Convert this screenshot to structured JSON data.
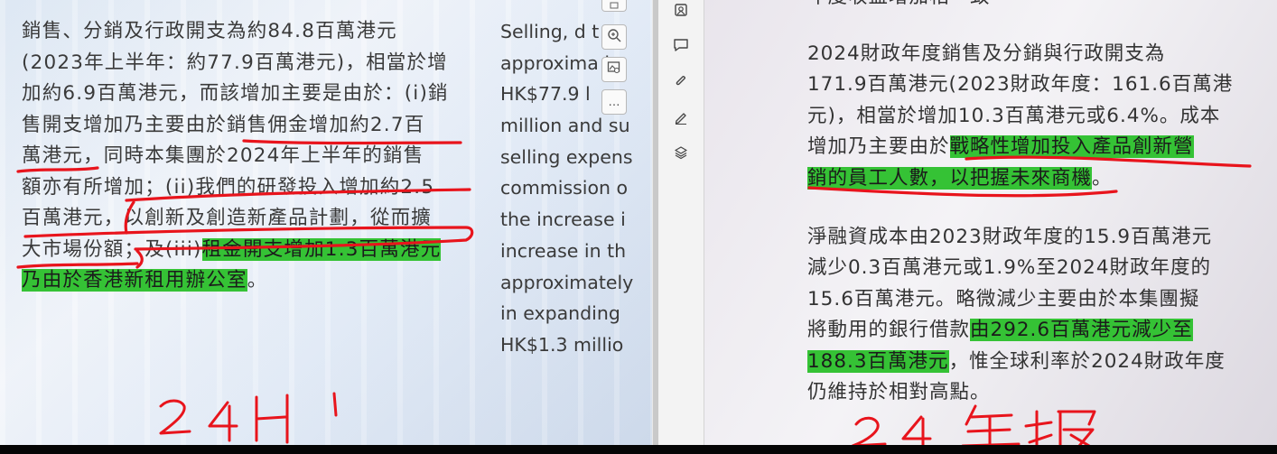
{
  "left_doc": {
    "zh_lines": [
      [
        {
          "t": "銷售、分銷及行政開支為約84.8百萬港元",
          "h": false
        }
      ],
      [
        {
          "t": "(2023年上半年：約77.9百萬港元)，相當於增",
          "h": false
        }
      ],
      [
        {
          "t": "加約6.9百萬港元，而該增加主要是由於：(i)銷",
          "h": false
        }
      ],
      [
        {
          "t": "售開支增加乃主要由於銷售佣金增加約2.7百",
          "h": false
        }
      ],
      [
        {
          "t": "萬港元，同時本集團於2024年上半年的銷售",
          "h": false
        }
      ],
      [
        {
          "t": "額亦有所增加；(ii)我們的研發投入增加約2.5",
          "h": false
        }
      ],
      [
        {
          "t": "百萬港元，以創新及創造新產品計劃，從而擴",
          "h": false
        }
      ],
      [
        {
          "t": "大市場份額；及(iii)",
          "h": false
        },
        {
          "t": "租金開支增加1.3百萬港元",
          "h": true
        }
      ],
      [
        {
          "t": "乃由於香港新租用辦公室",
          "h": true
        },
        {
          "t": "。",
          "h": false
        }
      ]
    ],
    "en_lines": [
      "Selling, d t",
      "approxima l",
      "HK$77.9   l",
      "million and su",
      "selling expens",
      "commission o",
      "the increase i",
      "increase in th",
      "approximately",
      "in expanding",
      "HK$1.3 millio"
    ],
    "handwritten_note": "24H 1"
  },
  "pdf_tools": [
    "zoom-in",
    "image-search",
    "more"
  ],
  "pdf_more_label": "…",
  "sidebar_tools": [
    "image",
    "comment",
    "attach",
    "pen",
    "layers"
  ],
  "right_doc": {
    "top_partial": "年度收益增加相一致",
    "para1": [
      [
        {
          "t": "2024財政年度銷售及分銷與行政開支為",
          "h": false
        }
      ],
      [
        {
          "t": "171.9百萬港元(2023財政年度：161.6百萬港",
          "h": false
        }
      ],
      [
        {
          "t": "元)，相當於增加10.3百萬港元或6.4%。成本",
          "h": false
        }
      ],
      [
        {
          "t": "增加乃主要由於",
          "h": false
        },
        {
          "t": "戰略性增加投入產品創新營",
          "h": true
        }
      ],
      [
        {
          "t": "銷的員工人數，以把握未來商機",
          "h": true
        },
        {
          "t": "。",
          "h": false
        }
      ]
    ],
    "para2": [
      [
        {
          "t": "淨融資成本由2023財政年度的15.9百萬港元",
          "h": false
        }
      ],
      [
        {
          "t": "減少0.3百萬港元或1.9%至2024財政年度的",
          "h": false
        }
      ],
      [
        {
          "t": "15.6百萬港元。略微減少主要由於本集團擬",
          "h": false
        }
      ],
      [
        {
          "t": "將動用的銀行借款",
          "h": false
        },
        {
          "t": "由292.6百萬港元減少至",
          "h": true
        }
      ],
      [
        {
          "t": "188.3百萬港元",
          "h": true
        },
        {
          "t": "，惟全球利率於2024財政年度",
          "h": false
        }
      ],
      [
        {
          "t": "仍維持於相對高點。",
          "h": false
        }
      ]
    ],
    "handwritten_note": "24年报"
  },
  "colors": {
    "highlight": "#35c235",
    "ink": "#e8141c"
  }
}
